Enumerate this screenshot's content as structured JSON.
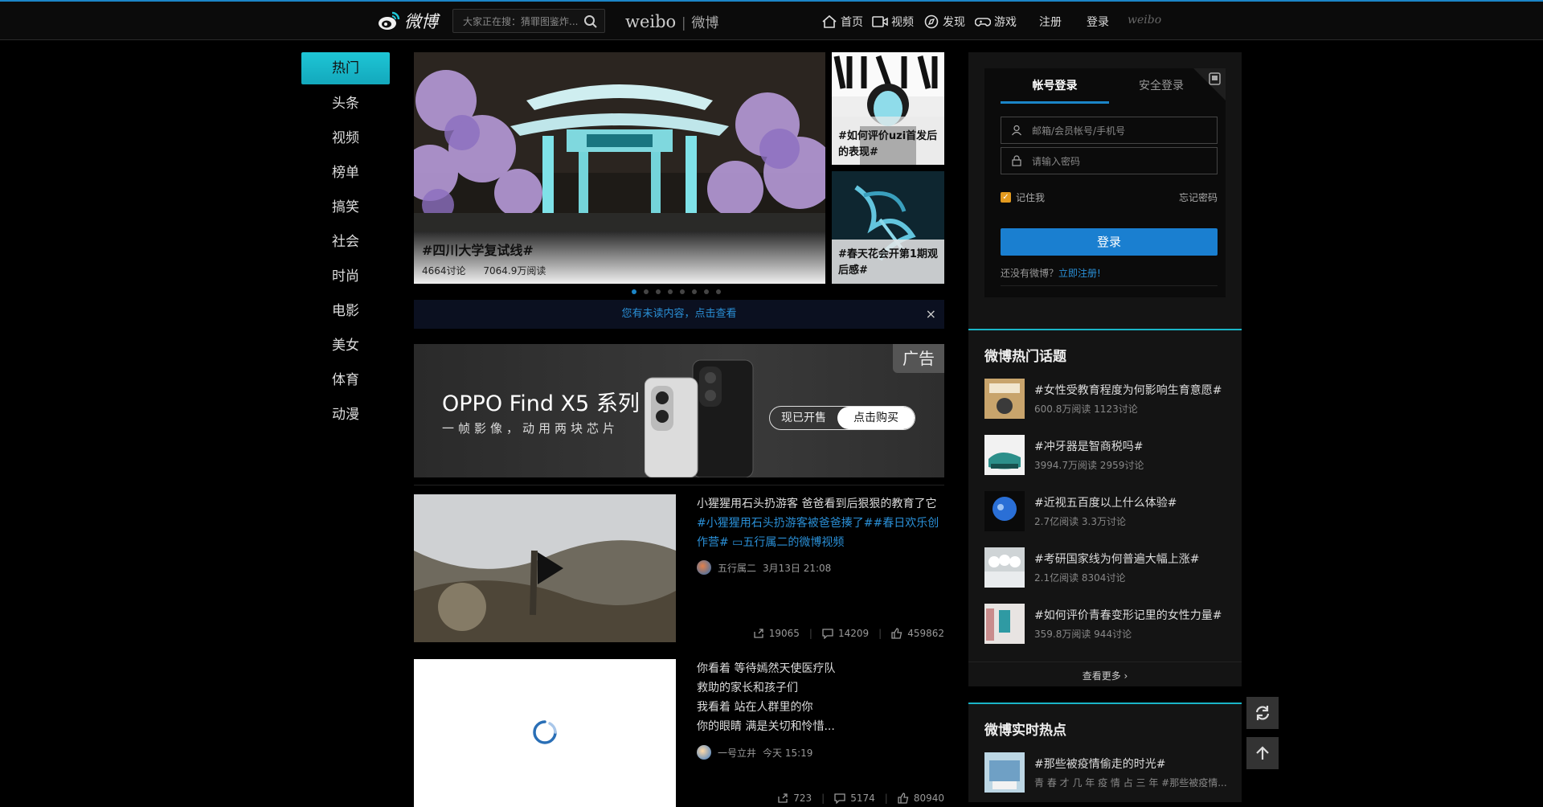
{
  "header": {
    "logo_text": "微博",
    "search_placeholder": "大家正在搜：猜罪图鉴炸...",
    "brand_en": "weibo",
    "brand_cn": "微博",
    "nav": [
      {
        "label": "首页",
        "icon": "home-icon"
      },
      {
        "label": "视频",
        "icon": "video-icon"
      },
      {
        "label": "发现",
        "icon": "compass-icon"
      },
      {
        "label": "游戏",
        "icon": "gamepad-icon"
      }
    ],
    "register": "注册",
    "login": "登录",
    "weibo_small": "weibo"
  },
  "left_nav": [
    "热门",
    "头条",
    "视频",
    "榜单",
    "搞笑",
    "社会",
    "时尚",
    "电影",
    "美女",
    "体育",
    "动漫"
  ],
  "carousel": {
    "main_title": "#四川大学复试线#",
    "main_discuss": "4664讨论",
    "main_read": "7064.9万阅读",
    "side1": "#如何评价uzi首发后的表现#",
    "side2": "#春天花会开第1期观后感#",
    "dots": 8,
    "active_dot": 0
  },
  "unread_bar": {
    "text": "您有未读内容，点击查看",
    "close": "×"
  },
  "ad": {
    "title": "OPPO Find X5",
    "title_suffix": " 系列",
    "subtitle": "一帧影像，动用两块芯片",
    "tag": "广告",
    "btn_presale": "现已开售",
    "btn_buy": "点击购买"
  },
  "feed": [
    {
      "text": "小猩猩用石头扔游客 爸爸看到后狠狠的教育了它",
      "tags": "#小猩猩用石头扔游客被爸爸揍了##春日欢乐创作营# ▭五行属二的微博视频",
      "author": "五行属二",
      "time": "3月13日 21:08",
      "shares": "19065",
      "comments": "14209",
      "likes": "459862"
    },
    {
      "lines": [
        "你看着 等待嫣然天使医疗队",
        "救助的家长和孩子们",
        "我看着 站在人群里的你",
        "你的眼睛 满是关切和怜惜..."
      ],
      "author": "一号立井",
      "time": "今天 15:19",
      "shares": "723",
      "comments": "5174",
      "likes": "80940"
    }
  ],
  "login_box": {
    "tab_account": "帐号登录",
    "tab_secure": "安全登录",
    "user_placeholder": "邮箱/会员帐号/手机号",
    "pwd_placeholder": "请输入密码",
    "remember": "记住我",
    "forgot": "忘记密码",
    "login_btn": "登录",
    "no_account": "还没有微博？",
    "register_now": "立即注册!"
  },
  "hot_topics": {
    "title": "微博热门话题",
    "items": [
      {
        "title": "#女性受教育程度为何影响生育意愿#",
        "meta": "600.8万阅读 1123讨论"
      },
      {
        "title": "#冲牙器是智商税吗#",
        "meta": "3994.7万阅读 2959讨论"
      },
      {
        "title": "#近视五百度以上什么体验#",
        "meta": "2.7亿阅读 3.3万讨论"
      },
      {
        "title": "#考研国家线为何普遍大幅上涨#",
        "meta": "2.1亿阅读 8304讨论"
      },
      {
        "title": "#如何评价青春变形记里的女性力量#",
        "meta": "359.8万阅读 944讨论"
      }
    ],
    "more": "查看更多 ›"
  },
  "realtime": {
    "title": "微博实时热点",
    "items": [
      {
        "title": "#那些被疫情偷走的时光#",
        "meta": "青 春 才 几 年 疫 情 占 三 年 #那些被疫情..."
      }
    ]
  },
  "colors": {
    "accent": "#1b85c7",
    "teal": "#1ab5c7",
    "background": "#000000"
  }
}
